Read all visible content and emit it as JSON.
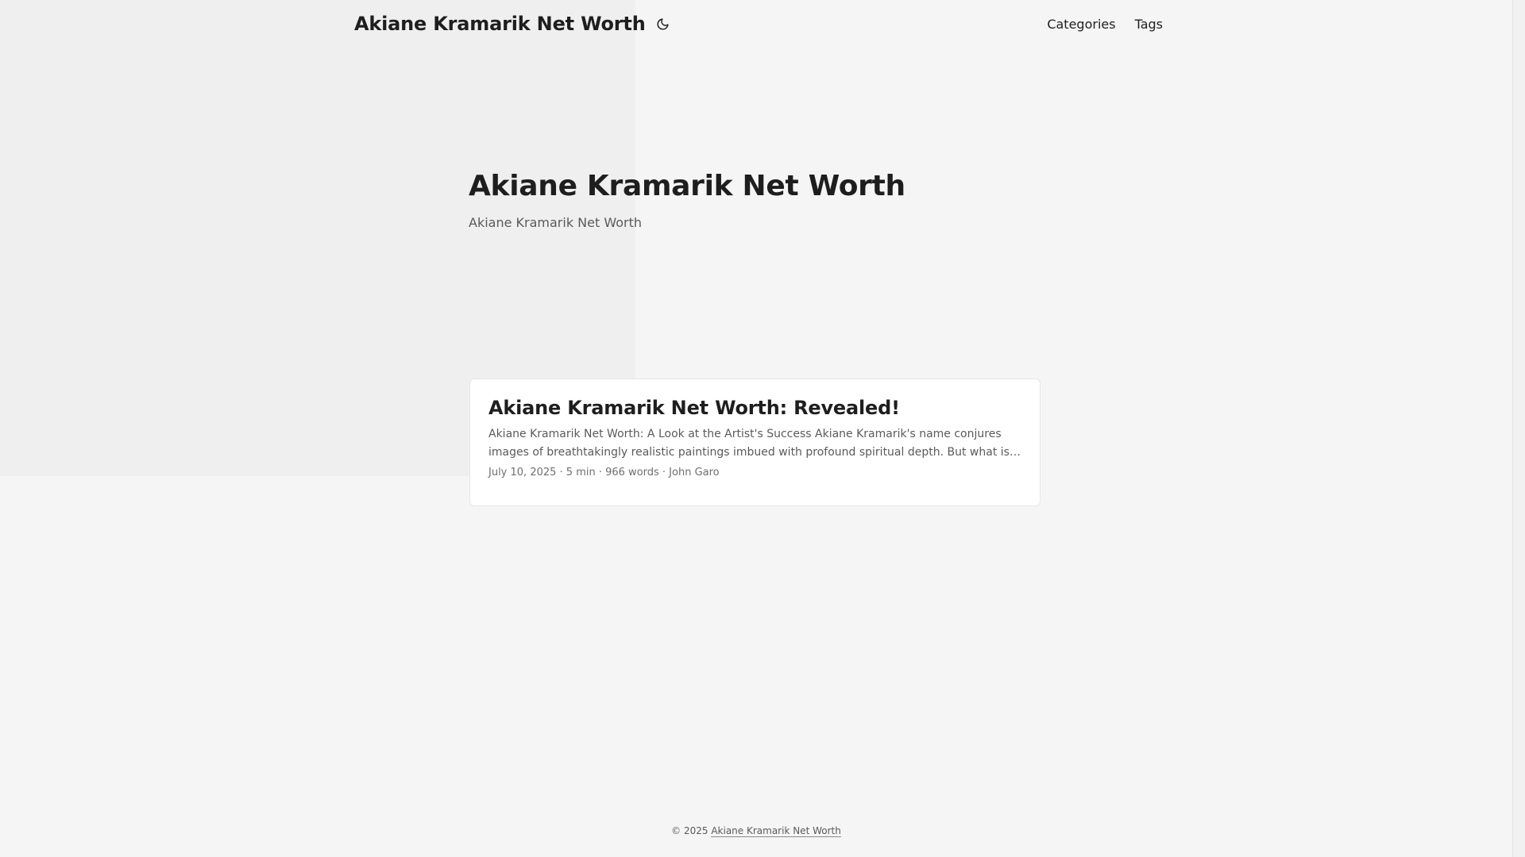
{
  "header": {
    "site_title": "Akiane Kramarik Net Worth",
    "theme_toggle_icon": "moon-icon",
    "nav": [
      {
        "label": "Categories"
      },
      {
        "label": "Tags"
      }
    ]
  },
  "hero": {
    "title": "Akiane Kramarik Net Worth",
    "subtitle": "Akiane Kramarik Net Worth"
  },
  "posts": [
    {
      "title": "Akiane Kramarik Net Worth: Revealed!",
      "summary": "Akiane Kramarik Net Worth: A Look at the Artist's Success Akiane Kramarik's name conjures images of breathtakingly realistic paintings imbued with profound spiritual depth. But what is the true extent of...",
      "meta": "July 10, 2025 · 5 min · 966 words · John Garo"
    }
  ],
  "footer": {
    "copyright": "© 2025",
    "link_label": "Akiane Kramarik Net Worth"
  },
  "colors": {
    "background": "#f5f5f5",
    "card": "#ffffff",
    "text": "#1e1e1e",
    "secondary_text": "#5a5a5a"
  }
}
